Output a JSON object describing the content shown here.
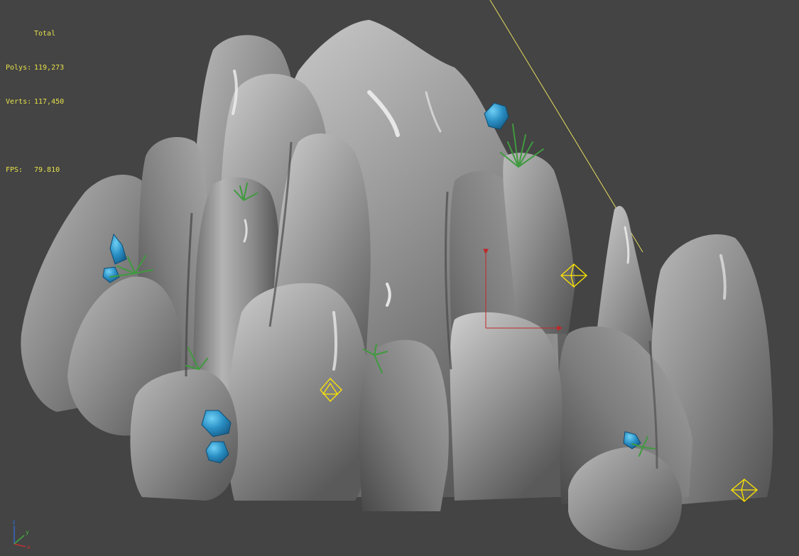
{
  "viewport": {
    "background": "#444444",
    "render_mode": "shaded",
    "subject": "rock-mountain-model"
  },
  "stats": {
    "title": "Total",
    "polys_label": "Polys:",
    "polys_value": "119,273",
    "verts_label": "Verts:",
    "verts_value": "117,450",
    "fps_label": "FPS:",
    "fps_value": "79.810",
    "text_color": "#e6e04a"
  },
  "gizmo": {
    "axis_x_label": "x",
    "axis_y_label": "y",
    "axis_z_label": "z",
    "x_color": "#d03030",
    "y_color": "#3fbf3f",
    "z_color": "#3070e0"
  },
  "objects": {
    "crystal_color": "#2a8fc4",
    "plant_color": "#3f9a3f",
    "helper_color": "#ffe600",
    "selection_axis_color": "#c02828",
    "light_line_color": "#e6dc60"
  },
  "icons": [
    "crystal-icon",
    "plant-icon",
    "helper-octahedron-icon",
    "axis-tripod-icon"
  ]
}
